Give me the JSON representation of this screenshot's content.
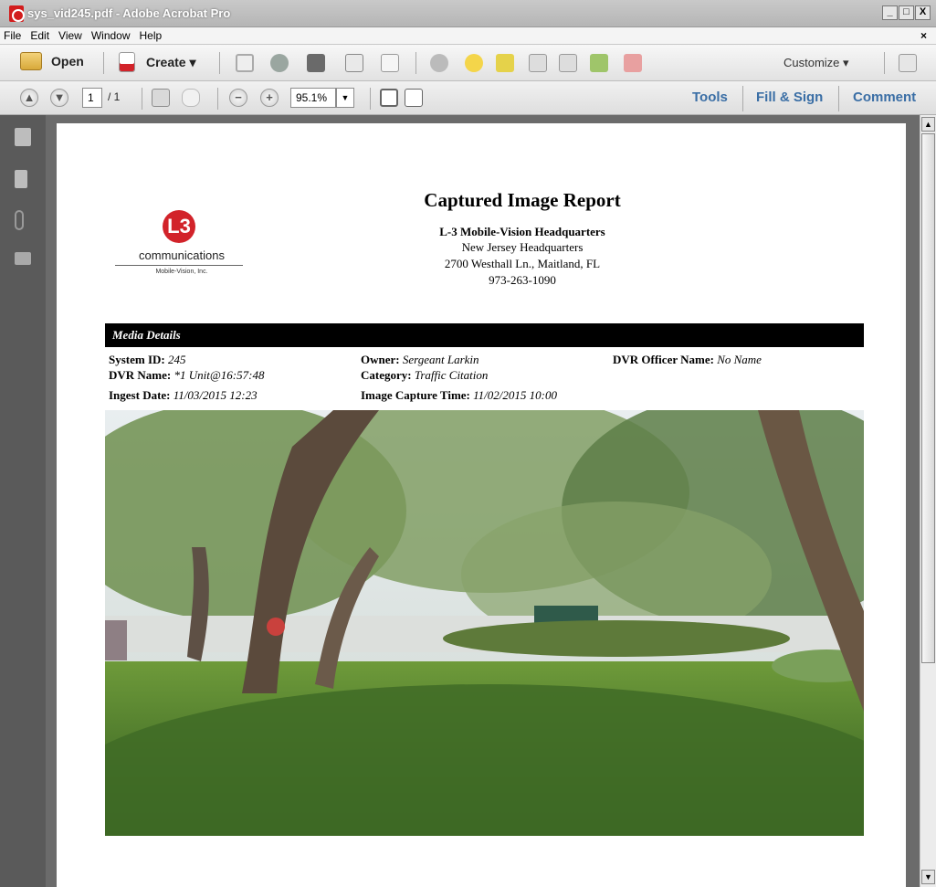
{
  "window": {
    "title": "sys_vid245.pdf - Adobe Acrobat Pro",
    "controls": [
      "_",
      "□",
      "X"
    ]
  },
  "menu": {
    "items": [
      "File",
      "Edit",
      "View",
      "Window",
      "Help"
    ],
    "close": "×"
  },
  "toolbar": {
    "open_label": "Open",
    "create_label": "Create ▾",
    "customize_label": "Customize ▾"
  },
  "nav": {
    "page_current": "1",
    "page_total": "/ 1",
    "zoom": "95.1%",
    "tools_label": "Tools",
    "fill_sign_label": "Fill & Sign",
    "comment_label": "Comment"
  },
  "report": {
    "logo_mark": "L3",
    "logo_word": "communications",
    "logo_sub": "Mobile-Vision, Inc.",
    "title": "Captured Image Report",
    "org": "L-3 Mobile-Vision Headquarters",
    "hq": "New Jersey Headquarters",
    "address": "2700 Westhall Ln., Maitland, FL",
    "phone": "973-263-1090",
    "section": "Media Details",
    "system_id_label": "System ID:",
    "system_id": "245",
    "dvr_name_label": "DVR Name:",
    "dvr_name": "*1 Unit@16:57:48",
    "ingest_label": "Ingest Date:",
    "ingest": "11/03/2015 12:23",
    "owner_label": "Owner:",
    "owner": "Sergeant Larkin",
    "category_label": "Category:",
    "category": "Traffic Citation",
    "capture_label": "Image Capture Time:",
    "capture": "11/02/2015 10:00",
    "officer_label": "DVR Officer Name:",
    "officer": "No Name"
  },
  "colors": {
    "accent_link": "#3a6ea5",
    "logo_red": "#d2232a",
    "section_bar": "#000000"
  }
}
